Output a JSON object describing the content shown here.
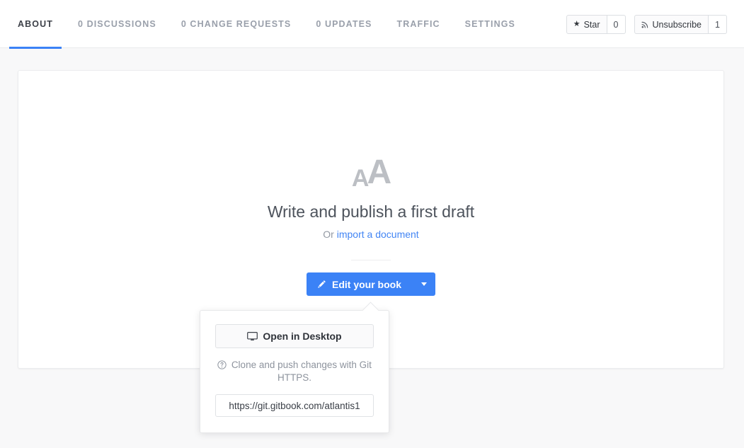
{
  "tabs": [
    {
      "label": "ABOUT",
      "active": true
    },
    {
      "label": "0 DISCUSSIONS",
      "active": false
    },
    {
      "label": "0 CHANGE REQUESTS",
      "active": false
    },
    {
      "label": "0 UPDATES",
      "active": false
    },
    {
      "label": "TRAFFIC",
      "active": false
    },
    {
      "label": "SETTINGS",
      "active": false
    }
  ],
  "header_actions": {
    "star": {
      "label": "Star",
      "icon": "star-icon",
      "count": "0"
    },
    "subscribe": {
      "label": "Unsubscribe",
      "icon": "rss-icon",
      "count": "1"
    }
  },
  "empty_state": {
    "icon": "aa-typography-icon",
    "icon_small_text": "A",
    "icon_large_text": "A",
    "headline": "Write and publish a first draft",
    "sub_prefix": "Or ",
    "sub_link": "import a document",
    "primary_button": {
      "label": "Edit your book",
      "icon": "pencil-icon",
      "caret": "chevron-down-icon"
    }
  },
  "dropdown": {
    "open_desktop": {
      "label": "Open in Desktop",
      "icon": "monitor-icon"
    },
    "clone_note": {
      "icon": "help-circle-icon",
      "text": "Clone and push changes with Git HTTPS."
    },
    "clone_url": {
      "value": "https://git.gitbook.com/atlantis1",
      "placeholder": "Clone URL"
    }
  },
  "colors": {
    "accent": "#3b82f6",
    "link": "#4285f4",
    "page_bg": "#f8f8f9",
    "muted_text": "#9aa0ab"
  }
}
